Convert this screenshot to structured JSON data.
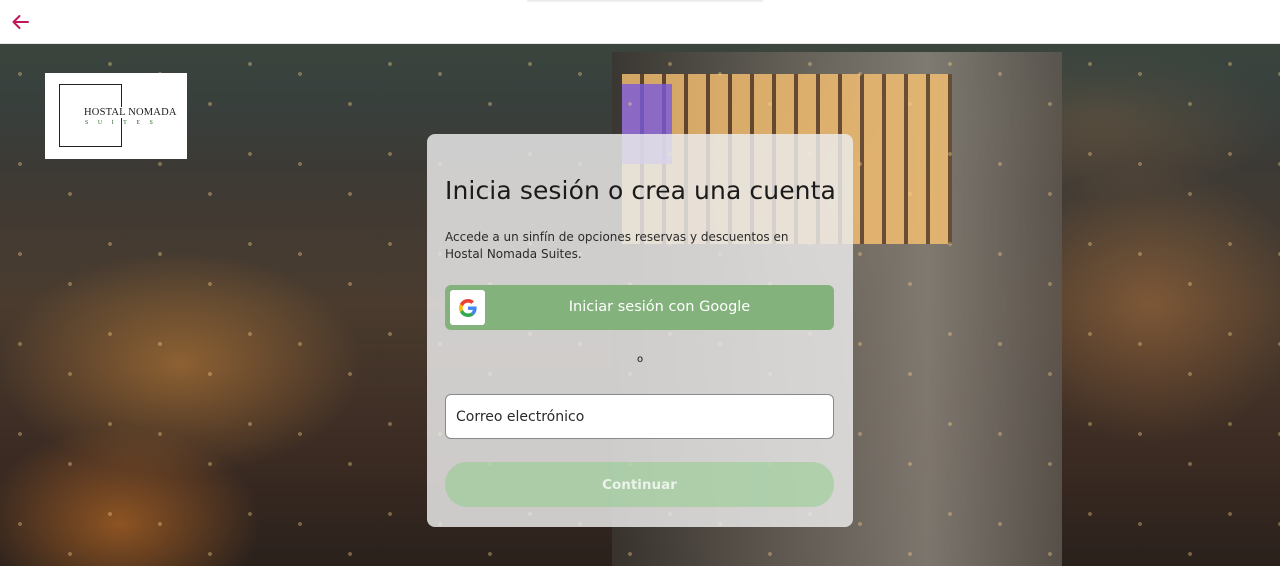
{
  "topbar": {
    "back_icon": "arrow-left-icon",
    "back_color": "#c2185b"
  },
  "logo": {
    "title": "HOSTAL NOMADA",
    "subtitle": "SUITES"
  },
  "login": {
    "title": "Inicia sesión o crea una cuenta",
    "description": "Accede a un sinfín de opciones reservas y descuentos en Hostal Nomada Suites.",
    "google_button_label": "Iniciar sesión con Google",
    "google_icon": "google-g-icon",
    "separator_text": "o",
    "email_placeholder": "Correo electrónico",
    "email_value": "",
    "continue_label": "Continuar"
  },
  "colors": {
    "google_button": "#83b27d",
    "continue_button_disabled": "#96cd91",
    "card_background": "#ebebeb"
  }
}
